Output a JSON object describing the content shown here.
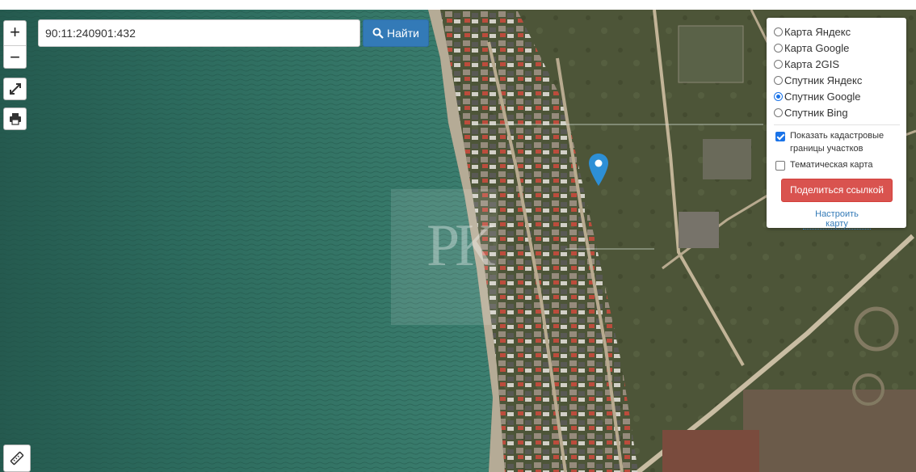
{
  "map": {
    "view": "satellite",
    "colors": {
      "water": "#2f6a5e",
      "land": "#4f5a3a",
      "accent": "#337ab7",
      "share": "#d9534f"
    },
    "watermark_text": "РК",
    "marker_icon": "map-pin-icon"
  },
  "controls": {
    "zoom_in": "+",
    "zoom_out": "−",
    "fullscreen_icon": "expand-icon",
    "print_icon": "printer-icon",
    "ruler_icon": "ruler-icon"
  },
  "search": {
    "value": "90:11:240901:432",
    "button_label": "Найти",
    "button_icon": "search-icon"
  },
  "layers": {
    "options": [
      {
        "label": "Карта Яндекс",
        "selected": false
      },
      {
        "label": "Карта Google",
        "selected": false
      },
      {
        "label": "Карта 2GIS",
        "selected": false
      },
      {
        "label": "Спутник Яндекс",
        "selected": false
      },
      {
        "label": "Спутник Google",
        "selected": true
      },
      {
        "label": "Спутник Bing",
        "selected": false
      }
    ],
    "checkboxes": [
      {
        "label": "Показать кадастровые границы участков",
        "checked": true
      },
      {
        "label": "Тематическая карта",
        "checked": false
      }
    ],
    "share_label": "Поделиться ссылкой",
    "configure_label": "Настроить карту"
  }
}
